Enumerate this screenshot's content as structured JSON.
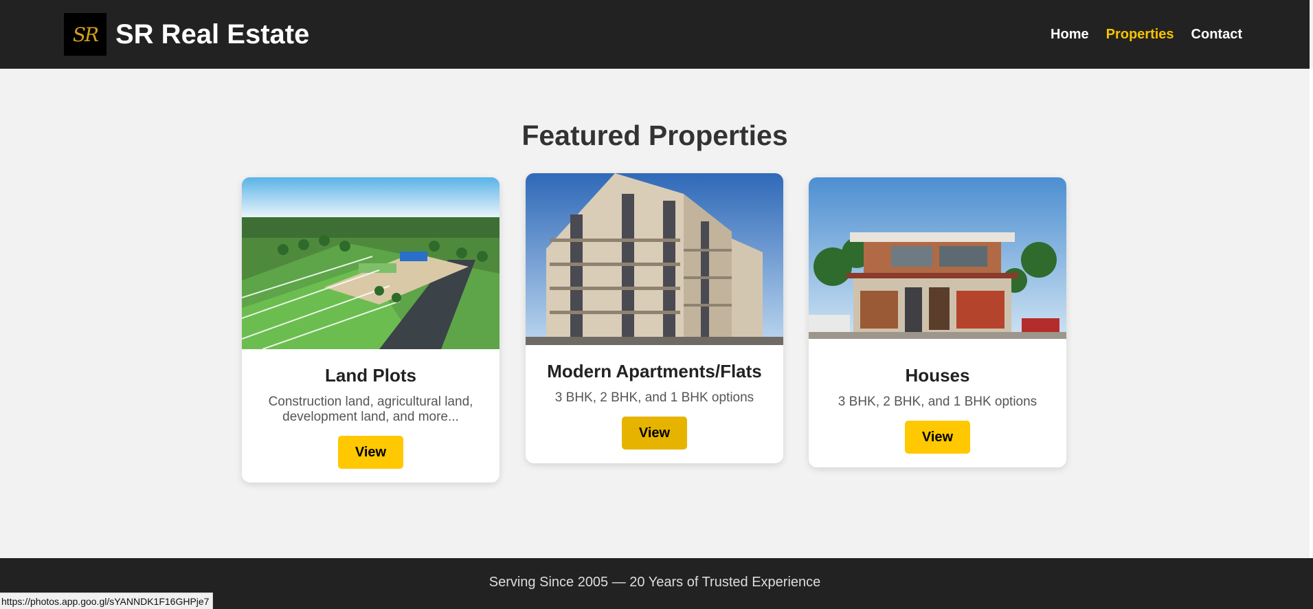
{
  "header": {
    "logo_text": "SR",
    "brand": "SR Real Estate",
    "nav": [
      {
        "label": "Home"
      },
      {
        "label": "Properties"
      },
      {
        "label": "Contact"
      }
    ]
  },
  "main": {
    "title": "Featured Properties",
    "cards": [
      {
        "title": "Land Plots",
        "description": "Construction land, agricultural land, development land, and more...",
        "button": "View"
      },
      {
        "title": "Modern Apartments/Flats",
        "description": "3 BHK, 2 BHK, and 1 BHK options",
        "button": "View"
      },
      {
        "title": "Houses",
        "description": "3 BHK, 2 BHK, and 1 BHK options",
        "button": "View"
      }
    ]
  },
  "footer": {
    "text": "Serving Since 2005 — 20 Years of Trusted Experience"
  },
  "status_bar": {
    "url": "https://photos.app.goo.gl/sYANNDK1F16GHPje7"
  },
  "colors": {
    "header_bg": "#222222",
    "accent": "#ffc800",
    "nav_active": "#f5c400",
    "page_bg": "#f2f2f2"
  },
  "icons": {
    "logo": "sr-monogram-logo"
  }
}
